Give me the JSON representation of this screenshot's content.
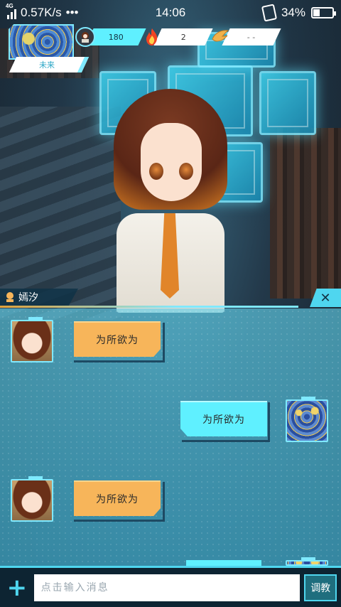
{
  "status_bar": {
    "network_type": "4G",
    "speed": "0.57K/s",
    "more": "•••",
    "time": "14:06",
    "battery_percent": "34%",
    "battery_level": 0.34
  },
  "profile": {
    "name": "未来"
  },
  "stats": [
    {
      "icon": "avatar-icon",
      "value": "180"
    },
    {
      "icon": "flame-icon",
      "value": "2"
    },
    {
      "icon": "wing-icon",
      "value": "- -"
    }
  ],
  "chat": {
    "partner_name": "嫣汐",
    "close_label": "✕",
    "messages": [
      {
        "sender": "her",
        "text": "为所欲为"
      },
      {
        "sender": "me",
        "text": "为所欲为"
      },
      {
        "sender": "her",
        "text": "为所欲为"
      }
    ]
  },
  "input": {
    "plus_label": "+",
    "placeholder": "点击输入消息",
    "tease_label": "调教"
  },
  "colors": {
    "accent_cyan": "#4fd6ef",
    "bubble_her": "#f7b55a",
    "bubble_me": "#5ff0ff"
  }
}
